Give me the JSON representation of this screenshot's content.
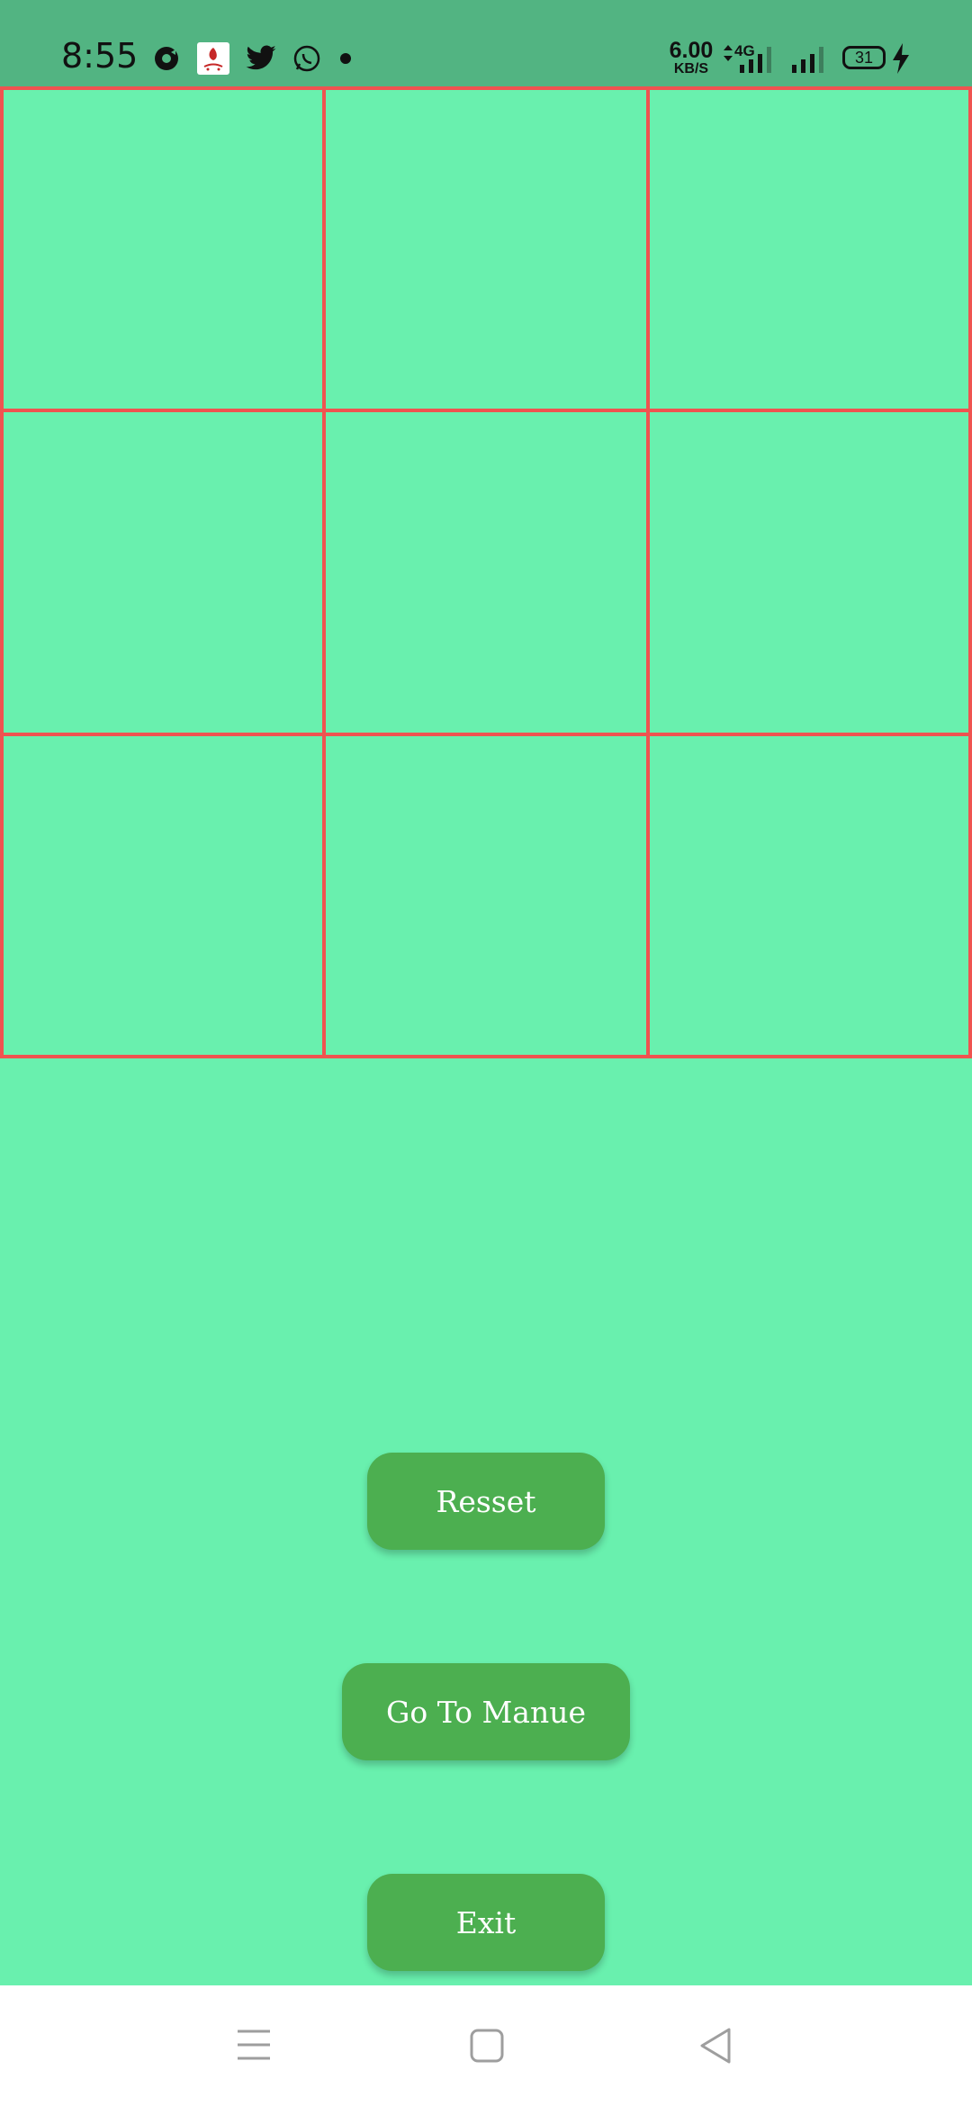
{
  "status_bar": {
    "time": "8:55",
    "net_speed_value": "6.00",
    "net_speed_unit": "KB/S",
    "network_type": "4G",
    "battery": "31",
    "icons": [
      "media-icon",
      "app-notification-icon",
      "twitter-icon",
      "whatsapp-icon",
      "more-notifications-dot-icon",
      "data-arrows-icon",
      "signal-4g-icon",
      "signal-icon",
      "battery-icon",
      "charging-bolt-icon"
    ]
  },
  "board": {
    "cells": [
      "",
      "",
      "",
      "",
      "",
      "",
      "",
      "",
      ""
    ]
  },
  "buttons": {
    "reset_label": "Resset",
    "menu_label": "Go To Manue",
    "exit_label": "Exit"
  },
  "nav_bar": {
    "icons": [
      "recents-icon",
      "home-icon",
      "back-icon"
    ]
  },
  "colors": {
    "background": "#69F0AE",
    "status_bar": "#52B482",
    "grid_line": "#EF5350",
    "button": "#4CAF50",
    "button_text": "#FFFFFF",
    "nav_bar": "#FFFFFF"
  }
}
